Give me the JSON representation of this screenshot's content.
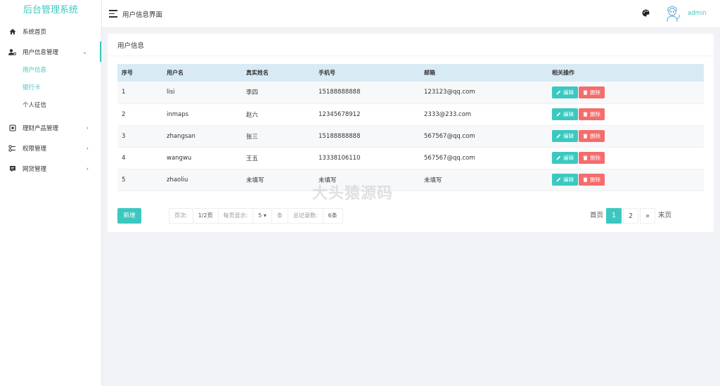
{
  "app": {
    "title": "后台管理系统"
  },
  "sidebar": {
    "items": [
      {
        "label": "系统首页",
        "icon": "home-icon"
      },
      {
        "label": "用户信息管理",
        "icon": "user-settings-icon",
        "expanded": true,
        "children": [
          {
            "label": "用户信息",
            "active": true
          },
          {
            "label": "银行卡",
            "active": false
          },
          {
            "label": "个人征信",
            "active": false
          }
        ]
      },
      {
        "label": "理财产品管理",
        "icon": "product-icon"
      },
      {
        "label": "权限管理",
        "icon": "permission-icon"
      },
      {
        "label": "网贷管理",
        "icon": "loan-icon"
      }
    ]
  },
  "header": {
    "page_title": "用户信息界面",
    "username": "admin"
  },
  "card": {
    "title": "用户信息"
  },
  "table": {
    "columns": [
      "序号",
      "用户名",
      "真实姓名",
      "手机号",
      "邮箱",
      "相关操作"
    ],
    "rows": [
      {
        "id": "1",
        "username": "lisi",
        "real_name": "李四",
        "phone": "15188888888",
        "email": "123123@qq.com"
      },
      {
        "id": "2",
        "username": "inmaps",
        "real_name": "赵六",
        "phone": "12345678912",
        "email": "2333@233.com"
      },
      {
        "id": "3",
        "username": "zhangsan",
        "real_name": "张三",
        "phone": "15188888888",
        "email": "567567@qq.com"
      },
      {
        "id": "4",
        "username": "wangwu",
        "real_name": "王五",
        "phone": "13338106110",
        "email": "567567@qq.com"
      },
      {
        "id": "5",
        "username": "zhaoliu",
        "real_name": "未填写",
        "phone": "未填写",
        "email": "未填写"
      }
    ],
    "edit_label": "编辑",
    "delete_label": "删除"
  },
  "actions": {
    "add_label": "新增"
  },
  "pagination": {
    "page_label": "页次:",
    "page_value": "1/2页",
    "per_page_label": "每页显示:",
    "per_page_value": "5",
    "per_page_unit": "条",
    "total_label": "总记录数:",
    "total_value": "6条",
    "first_label": "首页",
    "pages": [
      "1",
      "2"
    ],
    "next_label": "»",
    "last_label": "末页",
    "current_page": "1"
  },
  "watermark": "大头猿源码",
  "colors": {
    "accent": "#3bc8c0",
    "danger": "#f56c6c",
    "table_header": "#d8ebf5"
  }
}
